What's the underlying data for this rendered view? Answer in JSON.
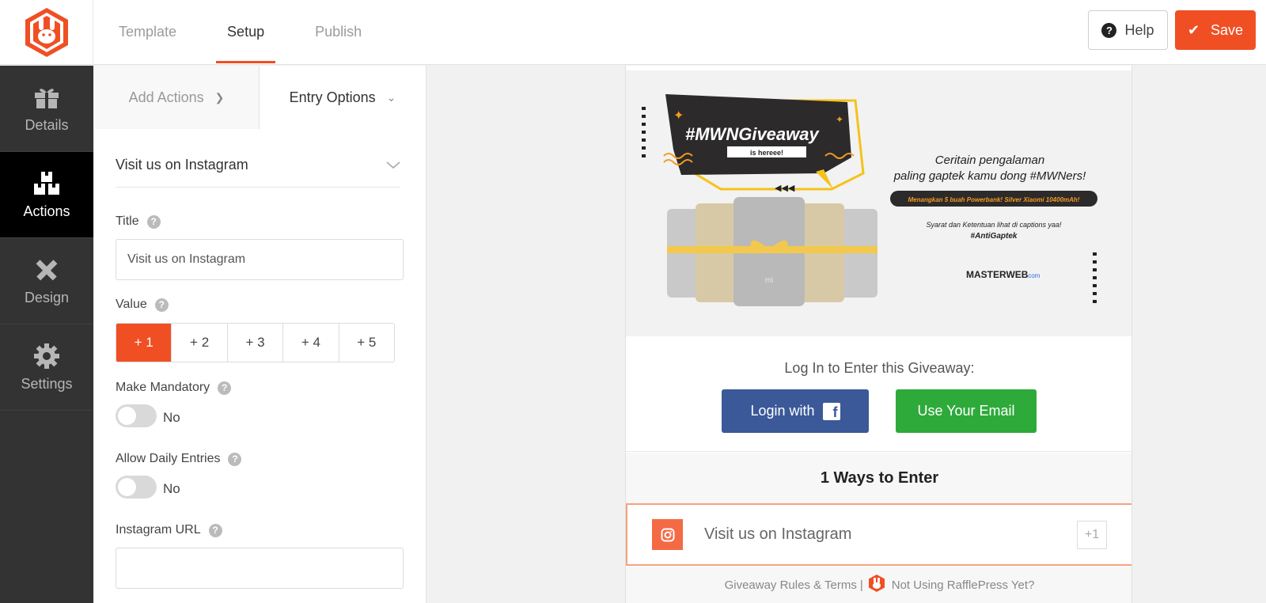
{
  "brand": {
    "accent": "#f04f24",
    "sidebar_bg": "#333333",
    "facebook": "#3b5998",
    "email_green": "#2eaa3a"
  },
  "logo": {
    "icon": "rabbit-logo-icon"
  },
  "top_tabs": [
    {
      "label": "Template",
      "active": false
    },
    {
      "label": "Setup",
      "active": true
    },
    {
      "label": "Publish",
      "active": false
    }
  ],
  "toolbar": {
    "help_label": "Help",
    "save_label": "Save"
  },
  "sidebar": {
    "items": [
      {
        "label": "Details",
        "icon": "gift-icon",
        "active": false
      },
      {
        "label": "Actions",
        "icon": "boxes-icon",
        "active": true
      },
      {
        "label": "Design",
        "icon": "pencil-ruler-icon",
        "active": false
      },
      {
        "label": "Settings",
        "icon": "gear-icon",
        "active": false
      }
    ]
  },
  "panel": {
    "subtabs": {
      "add_actions": "Add Actions",
      "entry_options": "Entry Options"
    },
    "section_title": "Visit us on Instagram",
    "title_label": "Title",
    "title_value": "Visit us on Instagram",
    "value_label": "Value",
    "value_options": [
      "+ 1",
      "+ 2",
      "+ 3",
      "+ 4",
      "+ 5"
    ],
    "value_selected": "+ 1",
    "mandatory_label": "Make Mandatory",
    "mandatory_value": "No",
    "daily_label": "Allow Daily Entries",
    "daily_value": "No",
    "instagram_url_label": "Instagram URL",
    "instagram_url_value": ""
  },
  "preview": {
    "banner": {
      "hashtag": "#MWNGiveaway",
      "hashtag_sub": "is hereee!",
      "headline_1": "Ceritain pengalaman",
      "headline_2": "paling gaptek kamu dong #MWNers!",
      "prize": "Menangkan 5 buah Powerbank! Silver Xiaomi 10400mAh!",
      "terms": "Syarat dan Ketentuan lihat di captions yaa!",
      "tag": "#AntiGaptek",
      "brand": "MASTERWEB",
      "brand_suffix": ".com",
      "powerbank_mark": "mi"
    },
    "login_title": "Log In to Enter this Giveaway:",
    "login_facebook": "Login with",
    "login_email": "Use Your Email",
    "ways_title": "1 Ways to Enter",
    "entry": {
      "label": "Visit us on Instagram",
      "value": "+1",
      "icon": "instagram-icon"
    },
    "footer": {
      "rules": "Giveaway Rules & Terms",
      "separator": "|",
      "cta": "Not Using RafflePress Yet?"
    }
  }
}
